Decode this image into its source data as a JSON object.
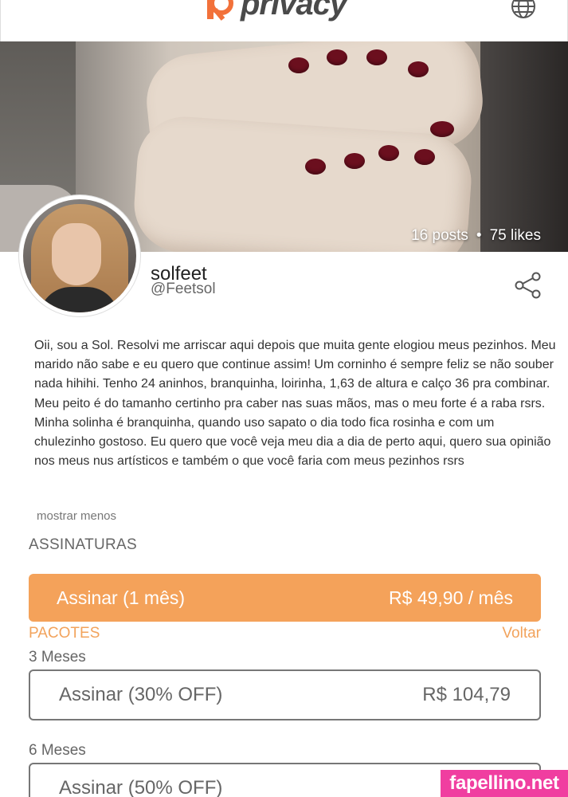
{
  "header": {
    "logo_text": "privacy",
    "logo_color": "#f2713a"
  },
  "profile": {
    "posts": "16 posts",
    "dot": "•",
    "likes": "75 likes",
    "name": "solfeet",
    "handle": "@Feetsol",
    "bio": "Oii, sou a Sol. Resolvi me arriscar aqui depois que muita gente elogiou meus pezinhos. Meu marido não sabe e eu quero que continue assim! Um corninho é sempre feliz se não souber nada hihihi. Tenho 24 aninhos, branquinha, loirinha, 1,63 de altura e calço 36 pra combinar. Meu peito é do tamanho certinho pra caber nas suas mãos, mas o meu forte é a raba rsrs. Minha solinha é branquinha, quando uso sapato o dia todo fica rosinha e com um chulezinho gostoso. Eu quero que você veja meu dia a dia de perto aqui, quero sua opinião nos meus nus artísticos e também o que você faria com meus pezinhos rsrs",
    "show_less": "mostrar menos"
  },
  "subscriptions": {
    "title": "ASSINATURAS",
    "main_label": "Assinar (1 mês)",
    "main_price": "R$ 49,90 / mês",
    "accent_color": "#f4a25a",
    "packages_title": "PACOTES",
    "back_label": "Voltar",
    "packages": [
      {
        "period": "3 Meses",
        "label": "Assinar (30% OFF)",
        "price": "R$ 104,79"
      },
      {
        "period": "6 Meses",
        "label": "Assinar (50% OFF)",
        "price": "R$"
      }
    ]
  },
  "watermark": "fapellino.net",
  "icons": [
    "globe-icon",
    "share-icon"
  ]
}
